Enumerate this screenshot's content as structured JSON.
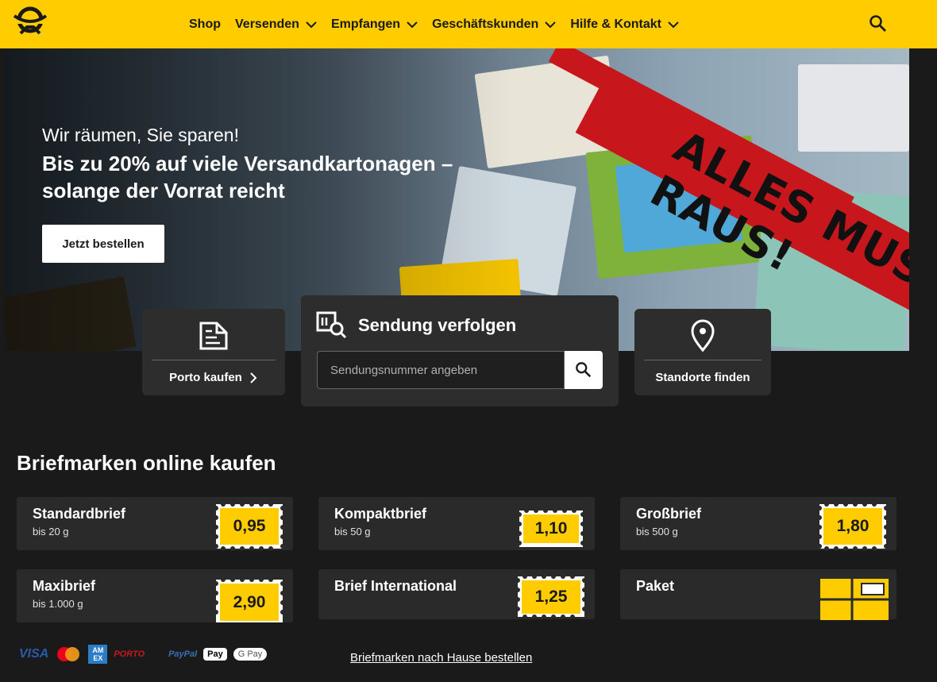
{
  "header": {
    "nav": [
      {
        "label": "Shop",
        "dropdown": false
      },
      {
        "label": "Versenden",
        "dropdown": true
      },
      {
        "label": "Empfangen",
        "dropdown": true
      },
      {
        "label": "Geschäftskunden",
        "dropdown": true
      },
      {
        "label": "Hilfe & Kontakt",
        "dropdown": true
      }
    ]
  },
  "hero": {
    "subtitle": "Wir räumen, Sie sparen!",
    "title": "Bis zu 20% auf viele Versandkartonagen – solange der Vorrat reicht",
    "cta": "Jetzt bestellen",
    "ribbon_text": "ALLES MUSS RAUS!"
  },
  "quick": {
    "porto": "Porto kaufen",
    "track_title": "Sendung verfolgen",
    "track_placeholder": "Sendungsnummer angeben",
    "standorte": "Standorte finden"
  },
  "stamps_section": {
    "title": "Briefmarken online kaufen",
    "products": [
      {
        "name": "Standardbrief",
        "weight": "bis 20 g",
        "price": "0,95"
      },
      {
        "name": "Kompaktbrief",
        "weight": "bis 50 g",
        "price": "1,10"
      },
      {
        "name": "Großbrief",
        "weight": "bis 500 g",
        "price": "1,80"
      },
      {
        "name": "Maxibrief",
        "weight": "bis 1.000 g",
        "price": "2,90"
      },
      {
        "name": "Brief International",
        "weight": "",
        "price": "1,25"
      },
      {
        "name": "Paket",
        "weight": "",
        "price": ""
      }
    ]
  },
  "footer": {
    "payments": [
      "VISA",
      "Mastercard",
      "AMEX",
      "PORTO",
      "PayPal",
      "Apple Pay",
      "G Pay"
    ],
    "payment_labels": {
      "visa": "VISA",
      "amex": "AM EX",
      "porto": "PORTO",
      "paypal": "PayPal",
      "applepay": "Pay",
      "gpay": "G Pay"
    },
    "home_link": "Briefmarken nach Hause bestellen"
  },
  "colors": {
    "brand_yellow": "#ffcc00",
    "background": "#1a1a1a",
    "card": "#2d2d2d",
    "ribbon": "#c8161d"
  }
}
